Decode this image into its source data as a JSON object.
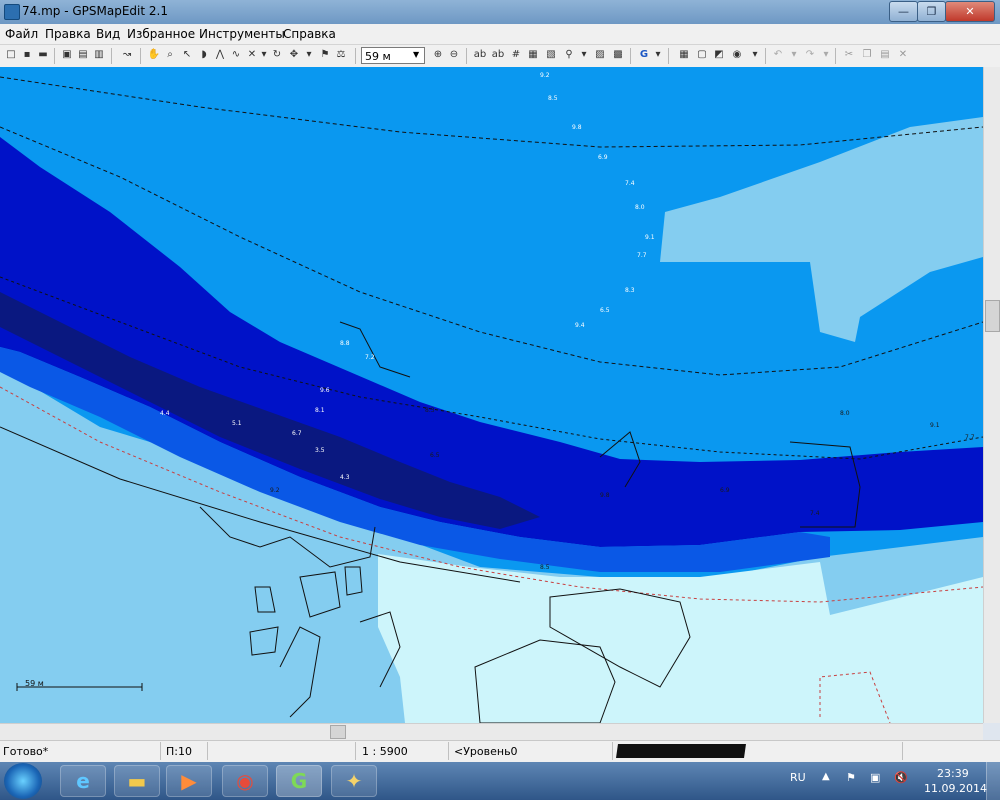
{
  "window": {
    "title": "74.mp - GPSMapEdit 2.1",
    "min": "—",
    "max": "❐",
    "close": "✕"
  },
  "menu": [
    "Файл",
    "Правка",
    "Вид",
    "Избранное",
    "Инструменты",
    "Справка"
  ],
  "toolbar": {
    "zoom_value": "59 м",
    "g_label": "G"
  },
  "map": {
    "scale_label": "59 м",
    "colors": {
      "deep": "#0a1880",
      "dark": "#0012c8",
      "mid": "#0a58e6",
      "blue": "#0a98f0",
      "shallow": "#84cdf0",
      "land": "#cdf5fb",
      "contour": "#1a1a1a",
      "dotted": "#c84040"
    },
    "depth_labels": [
      "9.2",
      "8.5",
      "9.8",
      "6.9",
      "7.4",
      "8.0",
      "9.1",
      "7.7",
      "8.3",
      "6.5",
      "9.4",
      "8.8",
      "7.2",
      "9.6",
      "8.1",
      "6.7",
      "3.5",
      "4.3",
      "5.1",
      "4.4"
    ]
  },
  "status": {
    "ready": "Готово*",
    "layer": "П:10",
    "scale": "1 : 5900",
    "level": "<Уровень0"
  },
  "taskbar": {
    "apps": [
      "explorer",
      "internet-explorer",
      "folder",
      "media-player",
      "chrome",
      "gpsmapedit",
      "map-viewer"
    ],
    "lang": "RU",
    "time": "23:39",
    "date": "11.09.2014"
  }
}
